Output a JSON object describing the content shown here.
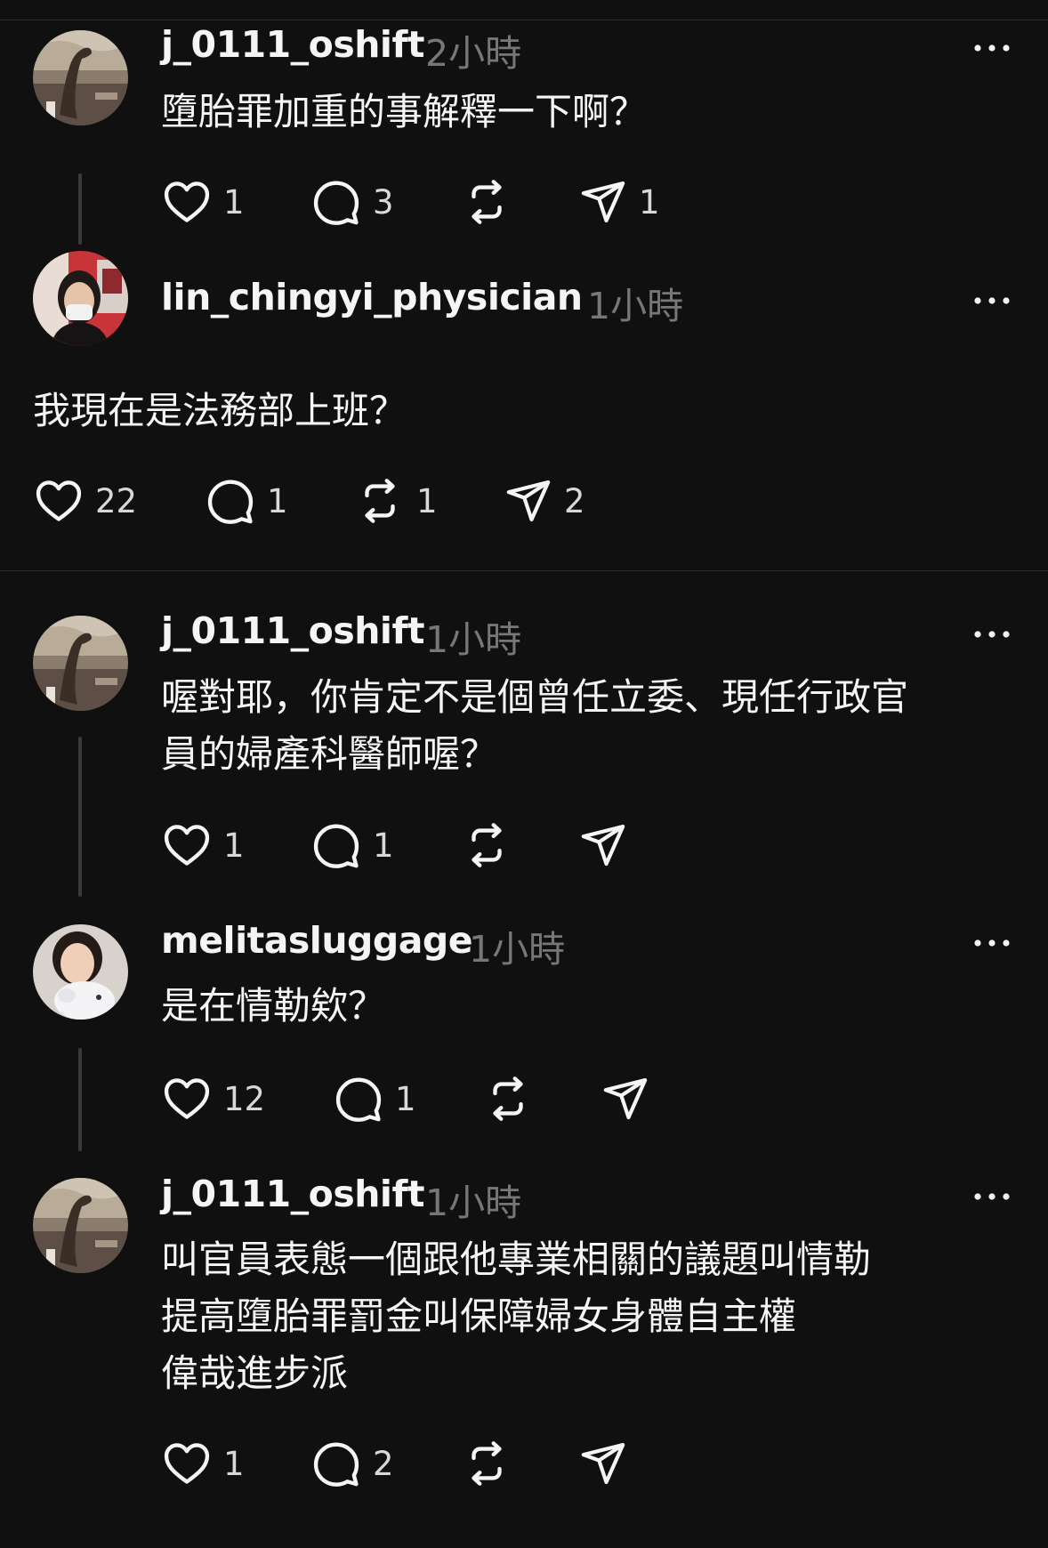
{
  "colors": {
    "background": "#101010",
    "text": "#f3f5f7",
    "muted": "#777777",
    "line": "#3a3a3a",
    "divider": "#2b2b2b"
  },
  "posts": [
    {
      "username": "j_0111_oshift",
      "time": "2小時",
      "text": "墮胎罪加重的事解釋一下啊？",
      "likes": "1",
      "comments": "3",
      "reposts": "",
      "shares": "1",
      "avatar": "dinosaur-avatar"
    },
    {
      "username": "lin_chingyi_physician",
      "time": "1小時",
      "text": "我現在是法務部上班？",
      "likes": "22",
      "comments": "1",
      "reposts": "1",
      "shares": "2",
      "avatar": "masked-woman-avatar"
    },
    {
      "username": "j_0111_oshift",
      "time": "1小時",
      "text": "喔對耶，你肯定不是個曾任立委、現任行政官\n員的婦產科醫師喔？",
      "likes": "1",
      "comments": "1",
      "reposts": "",
      "shares": "",
      "avatar": "dinosaur-avatar"
    },
    {
      "username": "melitasluggage",
      "time": "1小時",
      "text": "是在情勒欸？",
      "likes": "12",
      "comments": "1",
      "reposts": "",
      "shares": "",
      "avatar": "woman-with-plush-avatar"
    },
    {
      "username": "j_0111_oshift",
      "time": "1小時",
      "text": "叫官員表態一個跟他專業相關的議題叫情勒\n提高墮胎罪罰金叫保障婦女身體自主權\n偉哉進步派",
      "likes": "1",
      "comments": "2",
      "reposts": "",
      "shares": "",
      "avatar": "dinosaur-avatar"
    }
  ]
}
